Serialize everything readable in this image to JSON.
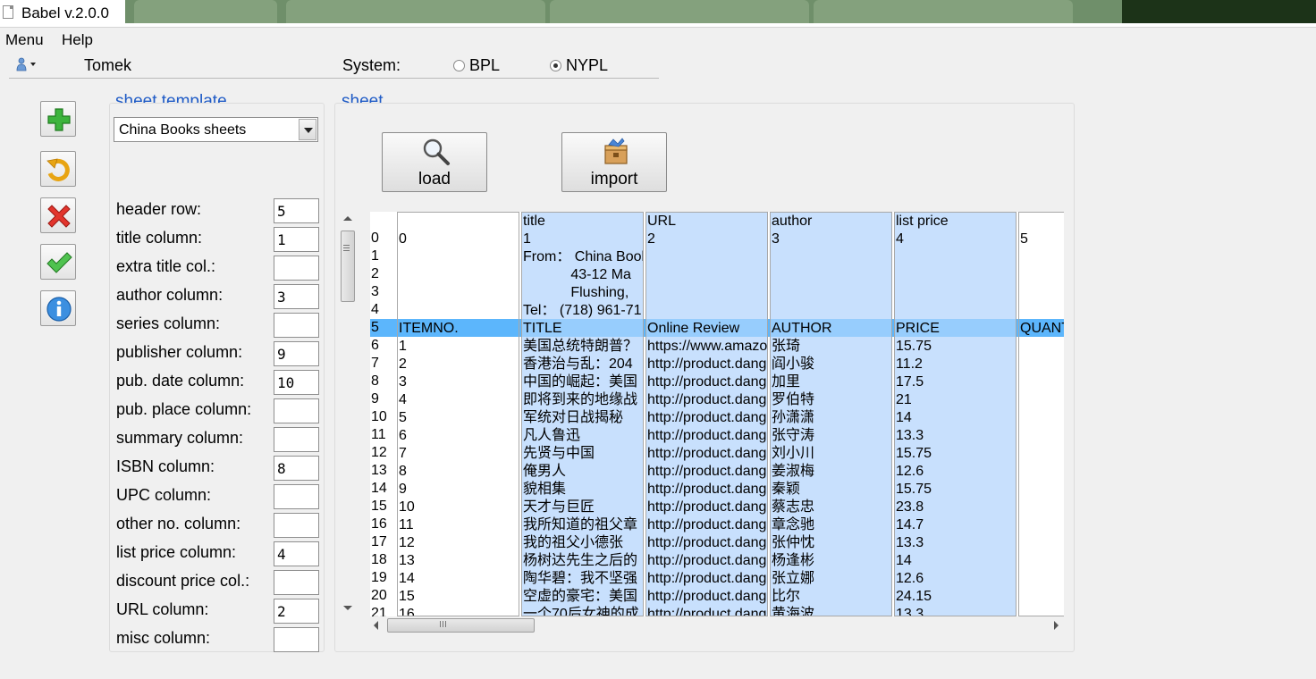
{
  "window": {
    "title": "Babel v.2.0.0"
  },
  "menu": {
    "items": [
      "Menu",
      "Help"
    ]
  },
  "user": {
    "name": "Tomek"
  },
  "system": {
    "label": "System:",
    "options": [
      "BPL",
      "NYPL"
    ],
    "selected": "NYPL"
  },
  "toolbar": {
    "buttons": [
      {
        "name": "add-button",
        "icon": "plus-icon"
      },
      {
        "name": "refresh-button",
        "icon": "refresh-arrow-icon"
      },
      {
        "name": "delete-button",
        "icon": "red-x-icon"
      },
      {
        "name": "save-button",
        "icon": "green-check-icon"
      },
      {
        "name": "info-button",
        "icon": "info-icon"
      }
    ]
  },
  "template": {
    "title": "sheet template",
    "selected": "China Books sheets",
    "fields": [
      {
        "label": "header row:",
        "value": "5"
      },
      {
        "label": "title column:",
        "value": "1"
      },
      {
        "label": "extra title col.:",
        "value": ""
      },
      {
        "label": "author column:",
        "value": "3"
      },
      {
        "label": "series column:",
        "value": ""
      },
      {
        "label": "publisher column:",
        "value": "9"
      },
      {
        "label": "pub. date column:",
        "value": "10"
      },
      {
        "label": "pub. place column:",
        "value": ""
      },
      {
        "label": "summary column:",
        "value": ""
      },
      {
        "label": "ISBN column:",
        "value": "8"
      },
      {
        "label": "UPC column:",
        "value": ""
      },
      {
        "label": "other no. column:",
        "value": ""
      },
      {
        "label": "list price column:",
        "value": "4"
      },
      {
        "label": "discount price col.:",
        "value": ""
      },
      {
        "label": "URL column:",
        "value": "2"
      },
      {
        "label": "misc column:",
        "value": ""
      }
    ]
  },
  "sheet": {
    "title": "sheet",
    "load_label": "load",
    "import_label": "import",
    "highlight_row_index": 6,
    "columns": [
      {
        "name": "grid-column-index",
        "header": "",
        "highlighted": false,
        "cells": [
          "",
          "0",
          "1",
          "2",
          "3",
          "4",
          "5",
          "6",
          "7",
          "8",
          "9",
          "10",
          "11",
          "12",
          "13",
          "14",
          "15",
          "16",
          "17",
          "18",
          "19",
          "20",
          "21"
        ]
      },
      {
        "name": "grid-column-0",
        "header": "",
        "highlighted": false,
        "cells": [
          "",
          "0",
          "",
          "",
          "",
          "",
          "ITEMNO.",
          "1",
          "2",
          "3",
          "4",
          "5",
          "6",
          "7",
          "8",
          "9",
          "10",
          "11",
          "12",
          "13",
          "14",
          "15",
          "16"
        ]
      },
      {
        "name": "grid-column-title",
        "header": "title",
        "highlighted": true,
        "cells": [
          "title",
          "1",
          "From： China Book",
          "            43-12 Ma",
          "            Flushing,",
          "Tel： (718) 961-71",
          "TITLE",
          "美国总统特朗普？",
          "香港治与乱：204",
          "中国的崛起：美国",
          "即将到来的地缘战",
          "军统对日战揭秘",
          "凡人鲁迅",
          "先贤与中国",
          "俺男人",
          "貌相集",
          "天才与巨匠",
          "我所知道的祖父章",
          "我的祖父小德张",
          "杨树达先生之后的",
          "陶华碧：我不坚强",
          "空虚的豪宅：美国",
          "一个70后女神的成"
        ]
      },
      {
        "name": "grid-column-url",
        "header": "URL",
        "highlighted": true,
        "cells": [
          "URL",
          "2",
          "",
          "",
          "",
          "",
          "Online Review",
          "https://www.amazo",
          "http://product.dang",
          "http://product.dang",
          "http://product.dang",
          "http://product.dang",
          "http://product.dang",
          "http://product.dang",
          "http://product.dang",
          "http://product.dang",
          "http://product.dang",
          "http://product.dang",
          "http://product.dang",
          "http://product.dang",
          "http://product.dang",
          "http://product.dang",
          "http://product.dang"
        ]
      },
      {
        "name": "grid-column-author",
        "header": "author",
        "highlighted": true,
        "cells": [
          "author",
          "3",
          "",
          "",
          "",
          "",
          "AUTHOR",
          "张琦",
          "阎小骏",
          "加里",
          "罗伯特",
          "孙潇潇",
          "张守涛",
          "刘小川",
          "姜淑梅",
          "秦颖",
          "蔡志忠",
          "章念驰",
          "张仲忱",
          "杨逢彬",
          "张立娜",
          "比尔",
          "黄海波"
        ]
      },
      {
        "name": "grid-column-list-price",
        "header": "list price",
        "highlighted": true,
        "cells": [
          "list price",
          "4",
          "",
          "",
          "",
          "",
          "PRICE",
          "15.75",
          "11.2",
          "17.5",
          "21",
          "14",
          "13.3",
          "15.75",
          "12.6",
          "15.75",
          "23.8",
          "14.7",
          "13.3",
          "14",
          "12.6",
          "24.15",
          "13.3"
        ]
      },
      {
        "name": "grid-column-5",
        "header": "",
        "highlighted": false,
        "cells": [
          "",
          "5",
          "",
          "",
          "",
          "",
          "QUANT",
          "",
          "",
          "",
          "",
          "",
          "",
          "",
          "",
          "",
          "",
          "",
          "",
          "",
          "",
          "",
          ""
        ]
      }
    ]
  }
}
